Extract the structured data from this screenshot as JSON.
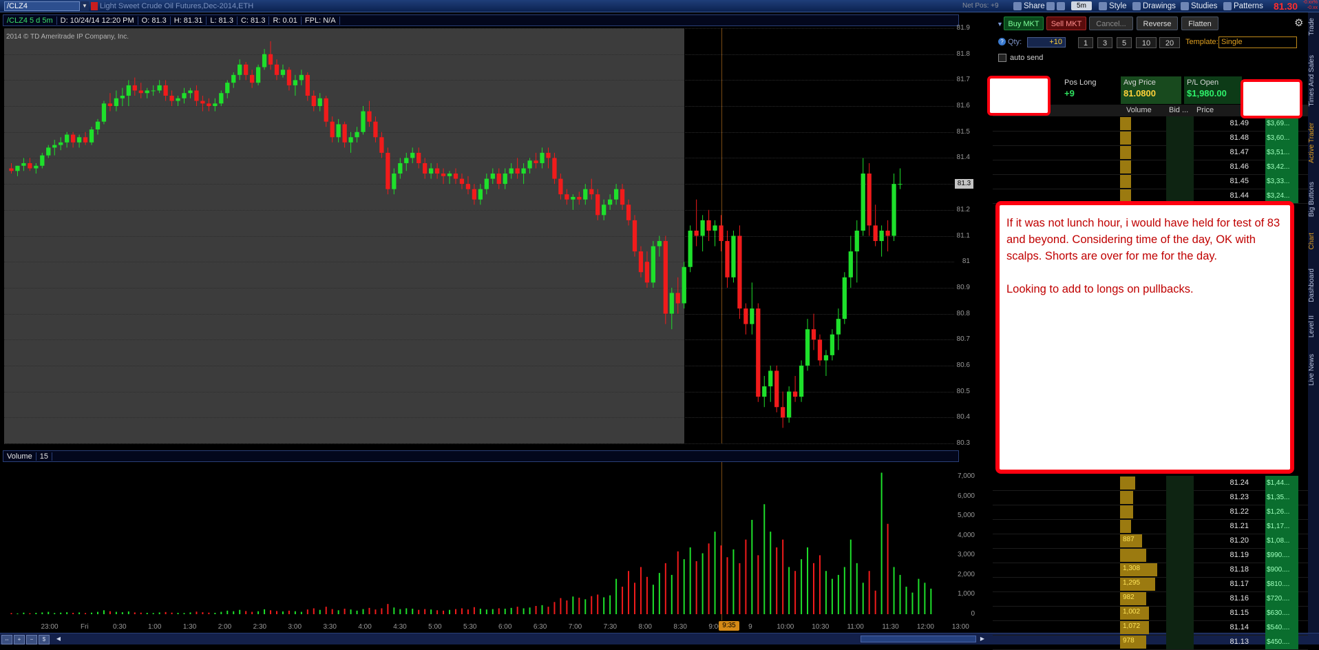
{
  "topbar": {
    "symbol": "/CLZ4",
    "description": "Light Sweet Crude Oil Futures,Dec-2014,ETH",
    "net_pos": "Net Pos: +9",
    "share_label": "Share",
    "timeframe": "5m",
    "style_label": "Style",
    "drawings_label": "Drawings",
    "studies_label": "Studies",
    "patterns_label": "Patterns",
    "last_price": "81.30",
    "last_change": "-0.xx% -0.xx"
  },
  "chart_header": {
    "symbol_period": "/CLZ4 5 d 5m",
    "date": "D: 10/24/14 12:20 PM",
    "open": "O: 81.3",
    "high": "H: 81.31",
    "low": "L: 81.3",
    "close": "C: 81.3",
    "range": "R: 0.01",
    "fpl": "FPL: N/A"
  },
  "copyright": "2014 © TD Ameritrade IP Company, Inc.",
  "price_axis": {
    "ticks": [
      "81.9",
      "81.8",
      "81.7",
      "81.6",
      "81.5",
      "81.4",
      "81.3",
      "81.2",
      "81.1",
      "81",
      "80.9",
      "80.8",
      "80.7",
      "80.6",
      "80.5",
      "80.4",
      "80.3"
    ],
    "current_tag": "81.3"
  },
  "volume_header": {
    "label": "Volume",
    "period": "15"
  },
  "volume_axis": {
    "ticks": [
      "7,000",
      "6,000",
      "5,000",
      "4,000",
      "3,000",
      "2,000",
      "1,000",
      "0"
    ]
  },
  "time_axis": {
    "ticks": [
      "23:00",
      "Fri",
      "0:30",
      "1:00",
      "1:30",
      "2:00",
      "2:30",
      "3:00",
      "3:30",
      "4:00",
      "4:30",
      "5:00",
      "5:30",
      "6:00",
      "6:30",
      "7:00",
      "7:30",
      "8:00",
      "8:30",
      "9:00",
      "9",
      "10:00",
      "10:30",
      "11:00",
      "11:30",
      "12:00",
      "13:00"
    ],
    "marker": "9:35"
  },
  "chart_data": {
    "type": "candlestick",
    "title": "",
    "xlabel": "",
    "ylabel": "",
    "ylim": [
      80.3,
      81.9
    ],
    "volume_ylim": [
      0,
      7500
    ],
    "premarket_shaded": true,
    "grid": true,
    "candles": [
      [
        81.36,
        81.38,
        81.34,
        81.35
      ],
      [
        81.35,
        81.37,
        81.33,
        81.37
      ],
      [
        81.37,
        81.4,
        81.35,
        81.38
      ],
      [
        81.38,
        81.4,
        81.35,
        81.36
      ],
      [
        81.36,
        81.38,
        81.34,
        81.37
      ],
      [
        81.37,
        81.42,
        81.36,
        81.41
      ],
      [
        81.41,
        81.45,
        81.4,
        81.44
      ],
      [
        81.44,
        81.47,
        81.41,
        81.45
      ],
      [
        81.45,
        81.48,
        81.43,
        81.46
      ],
      [
        81.46,
        81.5,
        81.44,
        81.49
      ],
      [
        81.49,
        81.5,
        81.44,
        81.46
      ],
      [
        81.46,
        81.49,
        81.44,
        81.48
      ],
      [
        81.48,
        81.5,
        81.45,
        81.46
      ],
      [
        81.46,
        81.52,
        81.45,
        81.51
      ],
      [
        81.51,
        81.55,
        81.49,
        81.54
      ],
      [
        81.54,
        81.62,
        81.53,
        81.61
      ],
      [
        81.61,
        81.65,
        81.58,
        81.6
      ],
      [
        81.6,
        81.66,
        81.58,
        81.63
      ],
      [
        81.63,
        81.67,
        81.6,
        81.64
      ],
      [
        81.64,
        81.7,
        81.6,
        81.68
      ],
      [
        81.68,
        81.71,
        81.64,
        81.66
      ],
      [
        81.66,
        81.69,
        81.63,
        81.65
      ],
      [
        81.65,
        81.67,
        81.63,
        81.66
      ],
      [
        81.66,
        81.68,
        81.64,
        81.66
      ],
      [
        81.66,
        81.7,
        81.65,
        81.68
      ],
      [
        81.68,
        81.7,
        81.62,
        81.64
      ],
      [
        81.64,
        81.66,
        81.6,
        81.62
      ],
      [
        81.62,
        81.64,
        81.6,
        81.63
      ],
      [
        81.63,
        81.67,
        81.61,
        81.65
      ],
      [
        81.65,
        81.67,
        81.63,
        81.66
      ],
      [
        81.66,
        81.68,
        81.6,
        81.62
      ],
      [
        81.62,
        81.64,
        81.58,
        81.61
      ],
      [
        81.61,
        81.63,
        81.58,
        81.6
      ],
      [
        81.6,
        81.63,
        81.58,
        81.61
      ],
      [
        81.61,
        81.66,
        81.6,
        81.65
      ],
      [
        81.65,
        81.7,
        81.63,
        81.69
      ],
      [
        81.69,
        81.73,
        81.67,
        81.72
      ],
      [
        81.72,
        81.78,
        81.7,
        81.76
      ],
      [
        81.76,
        81.77,
        81.7,
        81.72
      ],
      [
        81.72,
        81.74,
        81.67,
        81.69
      ],
      [
        81.69,
        81.76,
        81.68,
        81.75
      ],
      [
        81.75,
        81.82,
        81.74,
        81.8
      ],
      [
        81.8,
        81.85,
        81.74,
        81.76
      ],
      [
        81.76,
        81.78,
        81.7,
        81.72
      ],
      [
        81.72,
        81.76,
        81.71,
        81.74
      ],
      [
        81.74,
        81.75,
        81.66,
        81.68
      ],
      [
        81.68,
        81.72,
        81.64,
        81.7
      ],
      [
        81.7,
        81.74,
        81.68,
        81.72
      ],
      [
        81.72,
        81.73,
        81.62,
        81.64
      ],
      [
        81.64,
        81.66,
        81.58,
        81.6
      ],
      [
        81.6,
        81.65,
        81.58,
        81.63
      ],
      [
        81.63,
        81.64,
        81.52,
        81.54
      ],
      [
        81.54,
        81.56,
        81.46,
        81.48
      ],
      [
        81.48,
        81.55,
        81.46,
        81.53
      ],
      [
        81.53,
        81.54,
        81.44,
        81.46
      ],
      [
        81.46,
        81.5,
        81.42,
        81.48
      ],
      [
        81.48,
        81.52,
        81.46,
        81.5
      ],
      [
        81.5,
        81.6,
        81.49,
        81.58
      ],
      [
        81.58,
        81.62,
        81.52,
        81.54
      ],
      [
        81.54,
        81.56,
        81.46,
        81.48
      ],
      [
        81.48,
        81.5,
        81.4,
        81.42
      ],
      [
        81.42,
        81.44,
        81.26,
        81.28
      ],
      [
        81.28,
        81.36,
        81.26,
        81.34
      ],
      [
        81.34,
        81.4,
        81.32,
        81.38
      ],
      [
        81.38,
        81.42,
        81.35,
        81.4
      ],
      [
        81.4,
        81.44,
        81.38,
        81.42
      ],
      [
        81.42,
        81.44,
        81.36,
        81.38
      ],
      [
        81.38,
        81.4,
        81.32,
        81.34
      ],
      [
        81.34,
        81.38,
        81.32,
        81.36
      ],
      [
        81.36,
        81.38,
        81.32,
        81.34
      ],
      [
        81.34,
        81.36,
        81.3,
        81.33
      ],
      [
        81.33,
        81.35,
        81.3,
        81.34
      ],
      [
        81.34,
        81.36,
        81.3,
        81.32
      ],
      [
        81.32,
        81.34,
        81.28,
        81.3
      ],
      [
        81.3,
        81.33,
        81.26,
        81.28
      ],
      [
        81.28,
        81.3,
        81.22,
        81.24
      ],
      [
        81.24,
        81.3,
        81.22,
        81.28
      ],
      [
        81.28,
        81.34,
        81.26,
        81.32
      ],
      [
        81.32,
        81.36,
        81.3,
        81.34
      ],
      [
        81.34,
        81.36,
        81.28,
        81.3
      ],
      [
        81.3,
        81.36,
        81.28,
        81.34
      ],
      [
        81.34,
        81.38,
        81.32,
        81.36
      ],
      [
        81.36,
        81.4,
        81.32,
        81.34
      ],
      [
        81.34,
        81.38,
        81.3,
        81.36
      ],
      [
        81.36,
        81.4,
        81.34,
        81.39
      ],
      [
        81.39,
        81.42,
        81.36,
        81.38
      ],
      [
        81.38,
        81.44,
        81.36,
        81.42
      ],
      [
        81.42,
        81.44,
        81.36,
        81.4
      ],
      [
        81.4,
        81.42,
        81.3,
        81.32
      ],
      [
        81.32,
        81.34,
        81.24,
        81.26
      ],
      [
        81.26,
        81.28,
        81.22,
        81.24
      ],
      [
        81.24,
        81.26,
        81.2,
        81.25
      ],
      [
        81.25,
        81.27,
        81.22,
        81.24
      ],
      [
        81.24,
        81.3,
        81.22,
        81.28
      ],
      [
        81.28,
        81.32,
        81.24,
        81.26
      ],
      [
        81.26,
        81.28,
        81.16,
        81.18
      ],
      [
        81.18,
        81.24,
        81.16,
        81.22
      ],
      [
        81.22,
        81.26,
        81.2,
        81.24
      ],
      [
        81.24,
        81.3,
        81.22,
        81.28
      ],
      [
        81.28,
        81.3,
        81.2,
        81.22
      ],
      [
        81.22,
        81.24,
        81.14,
        81.16
      ],
      [
        81.16,
        81.18,
        81.02,
        81.04
      ],
      [
        81.04,
        81.06,
        80.94,
        80.96
      ],
      [
        81.0,
        81.04,
        80.9,
        80.92
      ],
      [
        80.92,
        81.08,
        80.9,
        81.06
      ],
      [
        81.06,
        81.1,
        81.02,
        81.08
      ],
      [
        81.08,
        81.1,
        80.76,
        80.8
      ],
      [
        80.8,
        80.9,
        80.74,
        80.88
      ],
      [
        80.88,
        80.94,
        80.8,
        80.84
      ],
      [
        80.84,
        81.0,
        80.82,
        80.98
      ],
      [
        80.98,
        81.14,
        80.96,
        81.12
      ],
      [
        81.12,
        81.24,
        81.06,
        81.1
      ],
      [
        81.1,
        81.18,
        81.04,
        81.16
      ],
      [
        81.16,
        81.2,
        81.08,
        81.12
      ],
      [
        81.12,
        81.16,
        81.06,
        81.14
      ],
      [
        81.14,
        81.18,
        81.04,
        81.08
      ],
      [
        81.08,
        81.12,
        80.9,
        80.94
      ],
      [
        80.94,
        81.12,
        80.92,
        81.1
      ],
      [
        81.1,
        81.14,
        80.78,
        80.82
      ],
      [
        80.82,
        80.84,
        80.72,
        80.76
      ],
      [
        80.76,
        80.92,
        80.72,
        80.82
      ],
      [
        80.82,
        80.84,
        80.46,
        80.48
      ],
      [
        80.48,
        80.56,
        80.44,
        80.52
      ],
      [
        80.52,
        80.6,
        80.46,
        80.58
      ],
      [
        80.58,
        80.6,
        80.42,
        80.44
      ],
      [
        80.44,
        80.5,
        80.36,
        80.4
      ],
      [
        80.4,
        80.52,
        80.38,
        80.5
      ],
      [
        80.5,
        80.56,
        80.46,
        80.48
      ],
      [
        80.48,
        80.62,
        80.46,
        80.6
      ],
      [
        80.6,
        80.78,
        80.58,
        80.74
      ],
      [
        80.74,
        80.8,
        80.66,
        80.7
      ],
      [
        80.7,
        80.72,
        80.6,
        80.62
      ],
      [
        80.62,
        80.66,
        80.56,
        80.64
      ],
      [
        80.64,
        80.74,
        80.62,
        80.72
      ],
      [
        80.72,
        80.82,
        80.66,
        80.78
      ],
      [
        80.78,
        80.96,
        80.76,
        80.94
      ],
      [
        80.94,
        81.1,
        80.9,
        81.04
      ],
      [
        81.04,
        81.16,
        80.92,
        81.12
      ],
      [
        81.12,
        81.4,
        81.1,
        81.34
      ],
      [
        81.34,
        81.38,
        81.1,
        81.14
      ],
      [
        81.14,
        81.22,
        81.06,
        81.08
      ],
      [
        81.08,
        81.14,
        81.02,
        81.12
      ],
      [
        81.12,
        81.16,
        81.04,
        81.1
      ],
      [
        81.1,
        81.34,
        81.08,
        81.3
      ],
      [
        81.3,
        81.36,
        81.28,
        81.3
      ]
    ],
    "volume": [
      60,
      40,
      80,
      50,
      70,
      90,
      120,
      60,
      80,
      100,
      70,
      90,
      60,
      80,
      120,
      200,
      150,
      120,
      100,
      140,
      90,
      80,
      70,
      60,
      90,
      110,
      80,
      70,
      60,
      90,
      130,
      100,
      80,
      70,
      120,
      180,
      150,
      220,
      160,
      120,
      150,
      250,
      200,
      160,
      140,
      180,
      150,
      120,
      240,
      300,
      220,
      380,
      260,
      200,
      280,
      240,
      180,
      260,
      320,
      240,
      300,
      520,
      340,
      260,
      300,
      280,
      220,
      260,
      240,
      200,
      180,
      220,
      260,
      300,
      240,
      360,
      280,
      240,
      260,
      300,
      280,
      320,
      380,
      300,
      340,
      420,
      460,
      380,
      620,
      820,
      700,
      900,
      840,
      760,
      920,
      1000,
      860,
      960,
      1800,
      1400,
      2200,
      1600,
      2400,
      1900,
      1500,
      2100,
      2600,
      2000,
      3200,
      2800,
      3400,
      2700,
      3100,
      3600,
      4200,
      3500,
      2900,
      3300,
      2600,
      3800,
      4800,
      3000,
      5600,
      4200,
      3400,
      3800,
      2400,
      2200,
      2800,
      3400,
      2600,
      3000,
      2200,
      1800,
      2000,
      2400,
      3800,
      2600,
      1600,
      2200,
      1200,
      7200,
      4600,
      2400,
      2000,
      1400,
      1100,
      1800,
      1600,
      1300
    ]
  },
  "right_panel": {
    "buttons": {
      "buy_mkt": "Buy MKT",
      "sell_mkt": "Sell MKT",
      "cancel": "Cancel...",
      "reverse": "Reverse",
      "flatten": "Flatten"
    },
    "qty_label": "Qty:",
    "qty_value": "+10",
    "qty_quick": [
      "1",
      "3",
      "5",
      "10",
      "20"
    ],
    "template_label": "Template:",
    "template_value": "Single",
    "auto_send": "auto send",
    "position": {
      "pos_long_label": "Pos Long",
      "pos_long_value": "+9",
      "avg_price_label": "Avg Price",
      "avg_price_value": "81.0800",
      "pl_open_label": "P/L Open",
      "pl_open_value": "$1,980.00"
    },
    "ladder_headers": {
      "volume": "Volume",
      "bid": "Bid ...",
      "price": "Price"
    },
    "ladder_top": [
      {
        "price": "81.49",
        "pl": "$3,69...",
        "vol": 0.5
      },
      {
        "price": "81.48",
        "pl": "$3,60...",
        "vol": 0.5
      },
      {
        "price": "81.47",
        "pl": "$3,51...",
        "vol": 0.5
      },
      {
        "price": "81.46",
        "pl": "$3,42...",
        "vol": 0.5
      },
      {
        "price": "81.45",
        "pl": "$3,33...",
        "vol": 0.5
      },
      {
        "price": "81.44",
        "pl": "$3,24...",
        "vol": 0.5
      }
    ],
    "ladder_bottom": [
      {
        "price": "81.24",
        "pl": "$1,44...",
        "vol": 0.7,
        "vol_label": ""
      },
      {
        "price": "81.23",
        "pl": "$1,35...",
        "vol": 0.6,
        "vol_label": ""
      },
      {
        "price": "81.22",
        "pl": "$1,26...",
        "vol": 0.6,
        "vol_label": ""
      },
      {
        "price": "81.21",
        "pl": "$1,17...",
        "vol": 0.5,
        "vol_label": ""
      },
      {
        "price": "81.20",
        "pl": "$1,08...",
        "vol": 1.0,
        "vol_label": "887"
      },
      {
        "price": "81.19",
        "pl": "$990....",
        "vol": 1.2,
        "vol_label": ""
      },
      {
        "price": "81.18",
        "pl": "$900....",
        "vol": 1.7,
        "vol_label": "1,308"
      },
      {
        "price": "81.17",
        "pl": "$810....",
        "vol": 1.6,
        "vol_label": "1,295"
      },
      {
        "price": "81.16",
        "pl": "$720....",
        "vol": 1.2,
        "vol_label": "982"
      },
      {
        "price": "81.15",
        "pl": "$630....",
        "vol": 1.3,
        "vol_label": "1,002"
      },
      {
        "price": "81.14",
        "pl": "$540....",
        "vol": 1.3,
        "vol_label": "1,072"
      },
      {
        "price": "81.13",
        "pl": "$450....",
        "vol": 1.2,
        "vol_label": "978"
      }
    ]
  },
  "note": {
    "line1": "If it was not lunch hour, i would have held for test of 83 and beyond. Considering time of the day, OK with scalps. Shorts are over for me for the day.",
    "line2": "Looking to add to longs on pullbacks."
  },
  "side_tabs": [
    "Trade",
    "Times And Sales",
    "Active Trader",
    "Big Buttons",
    "Chart",
    "Dashboard",
    "Level II",
    "Live News"
  ],
  "colors": {
    "up": "#1ee02b",
    "down": "#f11b1b",
    "accent": "#e0a020",
    "note_border": "#ff0010"
  }
}
